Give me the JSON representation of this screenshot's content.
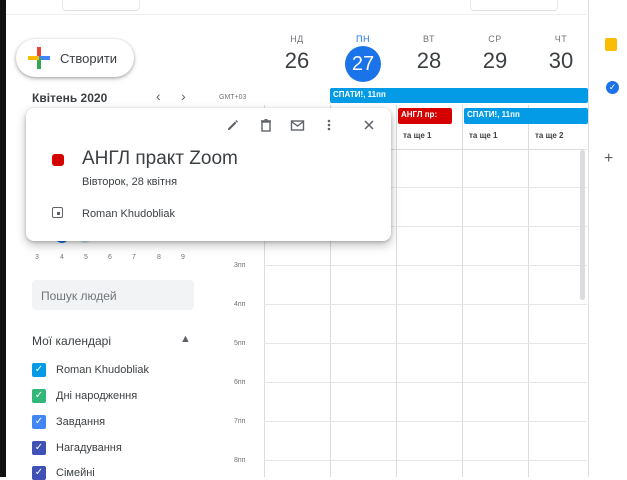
{
  "create_label": "Створити",
  "mini_calendar": {
    "title": "Квітень 2020",
    "prev": "‹",
    "next": "›",
    "days": [
      "3",
      "4",
      "5",
      "6",
      "7",
      "8",
      "9"
    ]
  },
  "timezone": "GMT+03",
  "week": [
    {
      "dow": "НД",
      "num": "26"
    },
    {
      "dow": "ПН",
      "num": "27"
    },
    {
      "dow": "ВТ",
      "num": "28"
    },
    {
      "dow": "СР",
      "num": "29"
    },
    {
      "dow": "ЧТ",
      "num": "30"
    }
  ],
  "events": {
    "allday_mon": "СПАТИ!, 11пп",
    "allday_tue": "АНГЛ пр:",
    "allday_wed": "СПАТИ!, 11пп"
  },
  "more": {
    "tue": "та ще 1",
    "wed": "та ще 1",
    "thu": "та ще 2"
  },
  "times": [
    "3пп",
    "4пп",
    "5пп",
    "6пп",
    "7пп",
    "8пп"
  ],
  "popup": {
    "title": "АНГЛ практ Zoom",
    "date": "Вівторок, 28 квітня",
    "owner": "Roman Khudobliak",
    "event_color": "#d50000"
  },
  "people_search_placeholder": "Пошук людей",
  "my_calendars": {
    "title": "Мої календарі",
    "items": [
      {
        "label": "Roman Khudobliak",
        "color": "#039be5"
      },
      {
        "label": "Дні народження",
        "color": "#33b679"
      },
      {
        "label": "Завдання",
        "color": "#4285f4"
      },
      {
        "label": "Нагадування",
        "color": "#3f51b5"
      },
      {
        "label": "Сімейні",
        "color": "#3f51b5"
      }
    ]
  },
  "colors": {
    "accent": "#1a73e8",
    "event_blue": "#039be5",
    "event_red": "#d50000"
  }
}
